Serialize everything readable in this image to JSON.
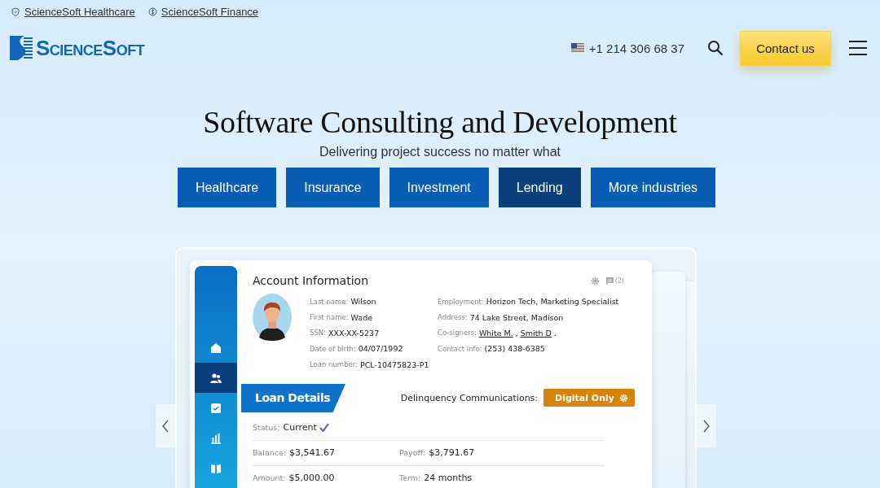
{
  "top_links": [
    {
      "label": "ScienceSoft Healthcare"
    },
    {
      "label": "ScienceSoft Finance"
    }
  ],
  "header": {
    "logo": "ScienceSoft",
    "phone": "+1 214 306 68 37",
    "contact_button": "Contact us"
  },
  "hero": {
    "title": "Software Consulting and Development",
    "subtitle": "Delivering project success no matter what"
  },
  "tabs": [
    {
      "label": "Healthcare",
      "selected": false
    },
    {
      "label": "Insurance",
      "selected": false
    },
    {
      "label": "Investment",
      "selected": false
    },
    {
      "label": "Lending",
      "selected": true
    },
    {
      "label": "More industries",
      "selected": false
    }
  ],
  "sidebar": [
    {
      "selected": false
    },
    {
      "selected": true
    },
    {
      "selected": false
    },
    {
      "selected": false
    },
    {
      "selected": false
    }
  ],
  "account": {
    "title": "Account Information",
    "comment_count": "(2)",
    "fields_left": [
      {
        "label": "Last name:",
        "value": "Wilson"
      },
      {
        "label": "First name:",
        "value": "Wade"
      },
      {
        "label": "SSN:",
        "value": "XXX-XX-5237"
      },
      {
        "label": "Date of birth:",
        "value": "04/07/1992"
      },
      {
        "label": "Loan number:",
        "value": "PCL-10475823-P1"
      }
    ],
    "fields_right": [
      {
        "label": "Employment:",
        "parts": [
          {
            "kind": "text",
            "text": "Horizon Tech, Marketing Specialist"
          }
        ]
      },
      {
        "label": "Address:",
        "parts": [
          {
            "kind": "text",
            "text": "74 Lake Street, Madison"
          }
        ]
      },
      {
        "label": "Co-signers:",
        "parts": [
          {
            "kind": "link",
            "text": "White M."
          },
          {
            "kind": "text",
            "text": ","
          },
          {
            "kind": "link",
            "text": "Smith D"
          },
          {
            "kind": "text",
            "text": "."
          }
        ]
      },
      {
        "label": "Contact info:",
        "parts": [
          {
            "kind": "text",
            "text": "(253) 438-6385"
          }
        ]
      }
    ]
  },
  "loan": {
    "title": "Loan Details",
    "delinquency_label": "Delinquency Communications:",
    "delinquency_button": "Digital Only",
    "status": {
      "label": "Status:",
      "value": "Current",
      "verified": true
    },
    "rows": [
      [
        {
          "label": "Balance:",
          "value": "$3,541.67"
        },
        {
          "label": "Payoff:",
          "value": "$3,791.67"
        }
      ],
      [
        {
          "label": "Amount:",
          "value": "$5,000.00"
        },
        {
          "label": "Term:",
          "value": "24 months"
        }
      ]
    ]
  }
}
